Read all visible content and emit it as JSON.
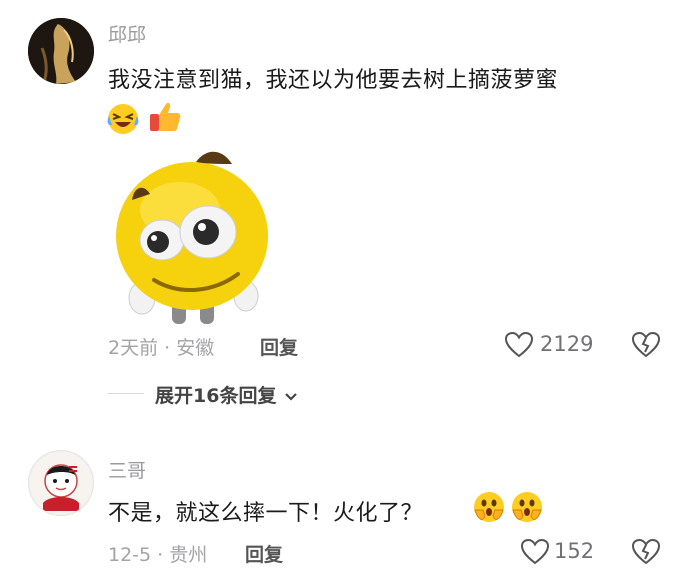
{
  "comments": [
    {
      "username": "邱邱",
      "text": "我没注意到猫，我还以为他要去树上摘菠萝蜜",
      "emojis": [
        "laughing-crying-emoji",
        "thumbs-up-emoji"
      ],
      "meta": "2天前 · 安徽",
      "reply_label": "回复",
      "like_count": "2129",
      "sticker": "yellow-smiley-sticker"
    },
    {
      "username": "三哥",
      "text": "不是，就这么摔一下！火化了？",
      "emojis": [
        "shocked-face-emoji",
        "shocked-face-emoji"
      ],
      "meta": "12-5 · 贵州",
      "reply_label": "回复",
      "like_count": "152"
    }
  ],
  "expand_replies_label": "展开16条回复",
  "colors": {
    "username": "#9a9aa0",
    "text": "#1a1a1a",
    "meta": "#a3a3a8",
    "sticker_yellow": "#f5d10e"
  }
}
